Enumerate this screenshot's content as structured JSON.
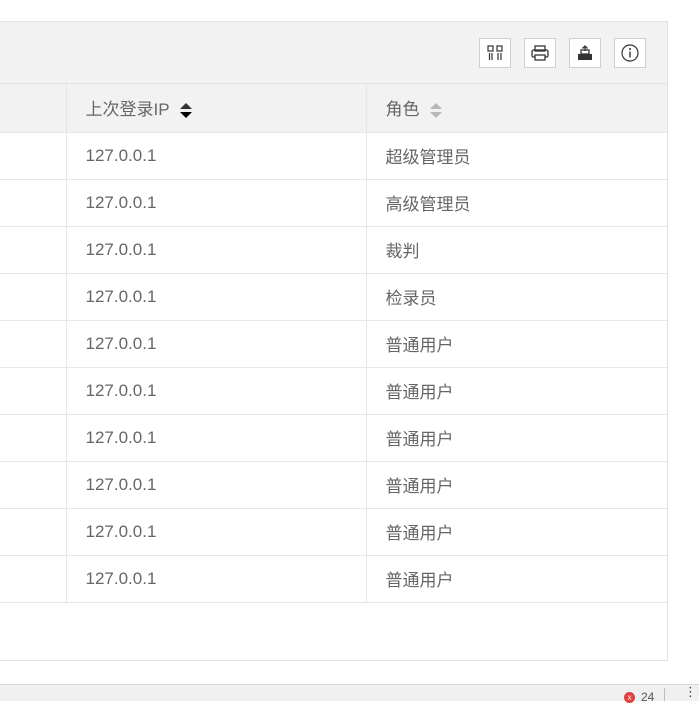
{
  "toolbar": {
    "buttons": [
      {
        "icon": "columns-icon",
        "label": "列"
      },
      {
        "icon": "print-icon",
        "label": "打印"
      },
      {
        "icon": "export-icon",
        "label": "导出"
      },
      {
        "icon": "info-icon",
        "label": "提示"
      }
    ]
  },
  "table": {
    "columns": [
      {
        "label": "",
        "sort": "none"
      },
      {
        "label": "上次登录IP",
        "sort": "active"
      },
      {
        "label": "角色",
        "sort": "inactive"
      }
    ],
    "rows": [
      {
        "ip": "127.0.0.1",
        "role": "超级管理员"
      },
      {
        "ip": "127.0.0.1",
        "role": "高级管理员"
      },
      {
        "ip": "127.0.0.1",
        "role": "裁判"
      },
      {
        "ip": "127.0.0.1",
        "role": "检录员"
      },
      {
        "ip": "127.0.0.1",
        "role": "普通用户"
      },
      {
        "ip": "127.0.0.1",
        "role": "普通用户"
      },
      {
        "ip": "127.0.0.1",
        "role": "普通用户"
      },
      {
        "ip": "127.0.0.1",
        "role": "普通用户"
      },
      {
        "ip": "127.0.0.1",
        "role": "普通用户"
      },
      {
        "ip": "127.0.0.1",
        "role": "普通用户"
      }
    ]
  },
  "statusbar": {
    "error_count": "24",
    "error_icon": "x",
    "menu_icon": "⋮"
  }
}
